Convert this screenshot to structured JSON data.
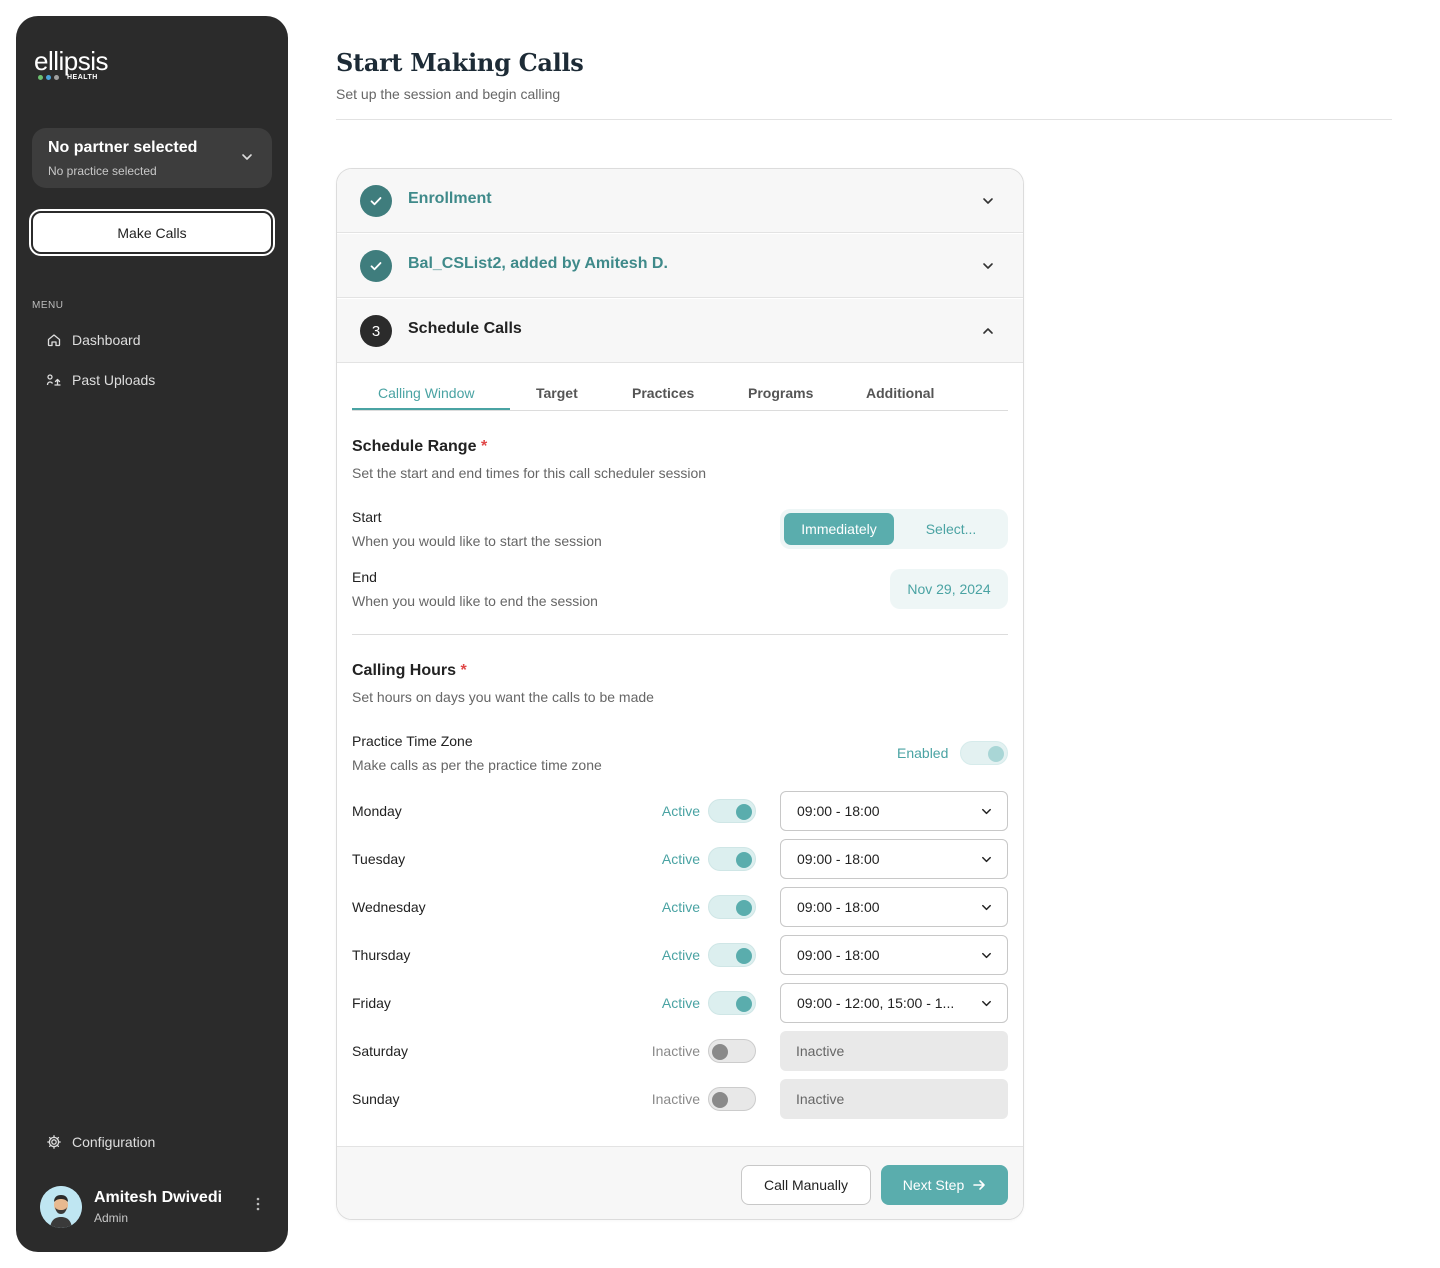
{
  "sidebar": {
    "logo": {
      "word": "ellipsis",
      "sub": "HEALTH"
    },
    "partner": {
      "title": "No partner selected",
      "subtitle": "No practice selected"
    },
    "make_calls_label": "Make Calls",
    "menu_label": "MENU",
    "items": [
      {
        "label": "Dashboard",
        "icon": "home-icon"
      },
      {
        "label": "Past Uploads",
        "icon": "uploads-icon"
      }
    ],
    "config_label": "Configuration",
    "user": {
      "name": "Amitesh Dwivedi",
      "role": "Admin"
    }
  },
  "header": {
    "title": "Start Making Calls",
    "subtitle": "Set up the session and begin calling"
  },
  "steps": [
    {
      "title": "Enrollment",
      "state": "complete"
    },
    {
      "title": "Bal_CSList2, added by Amitesh D.",
      "state": "complete"
    },
    {
      "title": "Schedule Calls",
      "state": "current",
      "number": "3"
    }
  ],
  "tabs": [
    "Calling Window",
    "Target",
    "Practices",
    "Programs",
    "Additional"
  ],
  "schedule_range": {
    "title": "Schedule Range",
    "required": "*",
    "subtitle": "Set the start and end times for this call scheduler session",
    "start_label": "Start",
    "start_sub": "When you would like to start the session",
    "start_options": [
      "Immediately",
      "Select..."
    ],
    "end_label": "End",
    "end_sub": "When you would like to end the session",
    "end_value": "Nov 29, 2024"
  },
  "calling_hours": {
    "title": "Calling Hours",
    "required": "*",
    "subtitle": "Set hours on days you want the calls to be made",
    "tz_label": "Practice Time Zone",
    "tz_sub": "Make calls as per the practice time zone",
    "tz_status": "Enabled",
    "days": [
      {
        "day": "Monday",
        "status": "Active",
        "hours": "09:00 - 18:00"
      },
      {
        "day": "Tuesday",
        "status": "Active",
        "hours": "09:00 - 18:00"
      },
      {
        "day": "Wednesday",
        "status": "Active",
        "hours": "09:00 - 18:00"
      },
      {
        "day": "Thursday",
        "status": "Active",
        "hours": "09:00 - 18:00"
      },
      {
        "day": "Friday",
        "status": "Active",
        "hours": "09:00 - 12:00, 15:00 - 1..."
      },
      {
        "day": "Saturday",
        "status": "Inactive",
        "hours": "Inactive"
      },
      {
        "day": "Sunday",
        "status": "Inactive",
        "hours": "Inactive"
      }
    ]
  },
  "footer": {
    "call_manually": "Call Manually",
    "next_step": "Next Step"
  },
  "colors": {
    "accent": "#5aadad",
    "accent_text": "#4aa3a3",
    "sidebar": "#2b2b2b",
    "required": "#e04848"
  }
}
